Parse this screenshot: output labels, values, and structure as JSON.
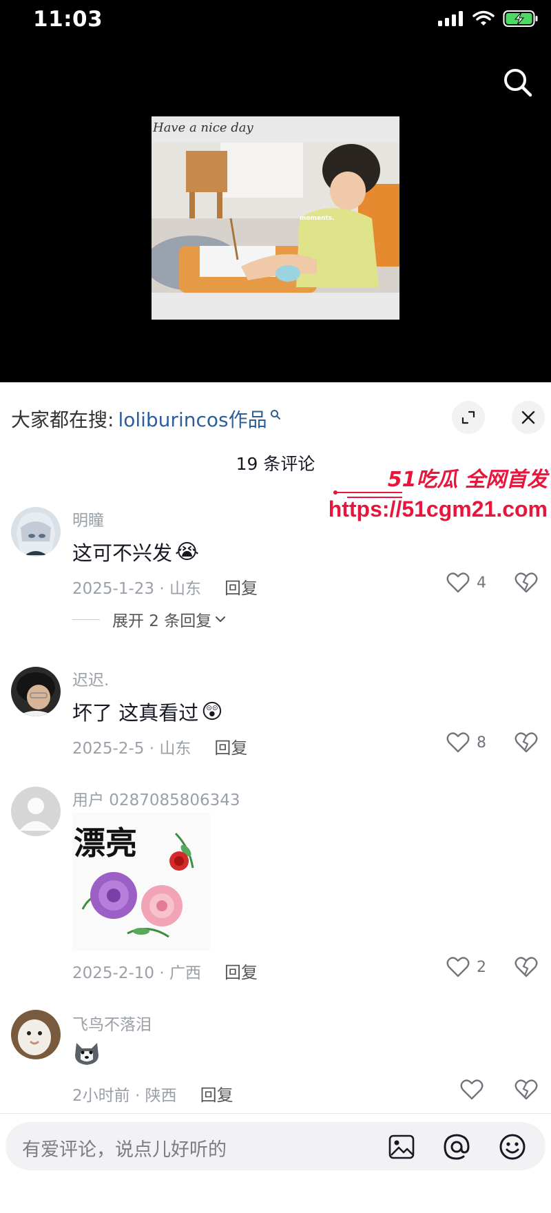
{
  "status_bar": {
    "time": "11:03"
  },
  "video": {
    "caption": "Have a nice day",
    "overlay_small": "moments."
  },
  "search_bar": {
    "prefix": "大家都在搜:",
    "term": "loliburincos作品"
  },
  "comments_header": {
    "count_label": "19 条评论"
  },
  "watermark": {
    "title": "51吃瓜 全网首发",
    "url": "https://51cgm21.com"
  },
  "comments": [
    {
      "username": "明瞳",
      "text": "这可不兴发",
      "emoji": "😭",
      "date_location": "2025-1-23 · 山东",
      "reply_label": "回复",
      "likes": "4",
      "expand_label": "展开 2 条回复"
    },
    {
      "username": "迟迟.",
      "text": "坏了 这真看过",
      "emoji": "😲",
      "date_location": "2025-2-5 · 山东",
      "reply_label": "回复",
      "likes": "8"
    },
    {
      "username": "用户 0287085806343",
      "sticker_text": "漂亮",
      "date_location": "2025-2-10 · 广西",
      "reply_label": "回复",
      "likes": "2"
    },
    {
      "username": "飞鸟不落泪",
      "date_location": "2小时前 · 陕西",
      "reply_label": "回复",
      "likes": ""
    }
  ],
  "input_bar": {
    "placeholder": "有爱评论，说点儿好听的"
  },
  "icons": [
    "signal-icon",
    "wifi-icon",
    "battery-icon",
    "search-icon",
    "expand-icon",
    "close-icon",
    "heart-icon",
    "broken-heart-icon",
    "chevron-down-icon",
    "image-icon",
    "at-icon",
    "emoji-icon"
  ],
  "colors": {
    "link": "#2d5e9c",
    "watermark": "#e8163c",
    "meta_gray": "#9aa0a8"
  }
}
